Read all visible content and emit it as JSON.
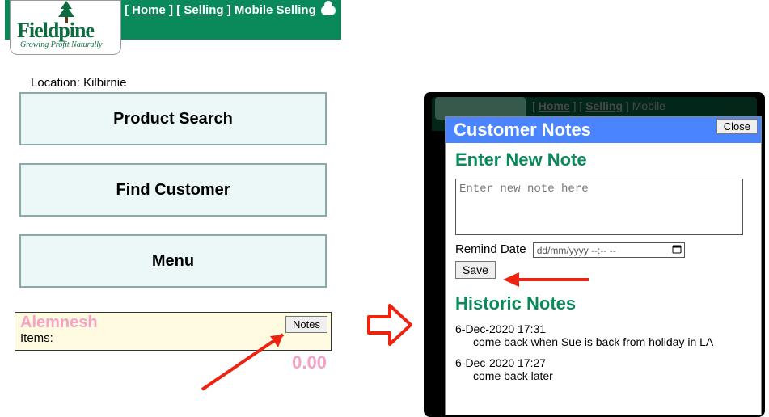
{
  "header": {
    "home": "Home",
    "selling": "Selling",
    "pageTitle": "Mobile Selling",
    "logoBrand": "Fieldpine",
    "logoSlogan": "Growing Profit Naturally"
  },
  "location": {
    "label": "Location:",
    "value": "Kilbirnie"
  },
  "buttons": {
    "productSearch": "Product Search",
    "findCustomer": "Find Customer",
    "menu": "Menu"
  },
  "customer": {
    "name": "Alemnesh",
    "itemsLabel": "Items:",
    "notesButton": "Notes",
    "total": "0.00"
  },
  "dialog": {
    "title": "Customer Notes",
    "close": "Close",
    "enterHeading": "Enter New Note",
    "notePlaceholder": "Enter new note here",
    "remindLabel": "Remind Date",
    "datePlaceholder": "dd/mm/yyyy --:-- --",
    "save": "Save",
    "histHeading": "Historic Notes",
    "history": [
      {
        "ts": "6-Dec-2020 17:31",
        "text": "come back when Sue is back from holiday in LA"
      },
      {
        "ts": "6-Dec-2020 17:27",
        "text": "come back later"
      }
    ]
  },
  "dimHeader": {
    "home": "Home",
    "selling": "Selling",
    "pageTitle": "Mobile"
  }
}
